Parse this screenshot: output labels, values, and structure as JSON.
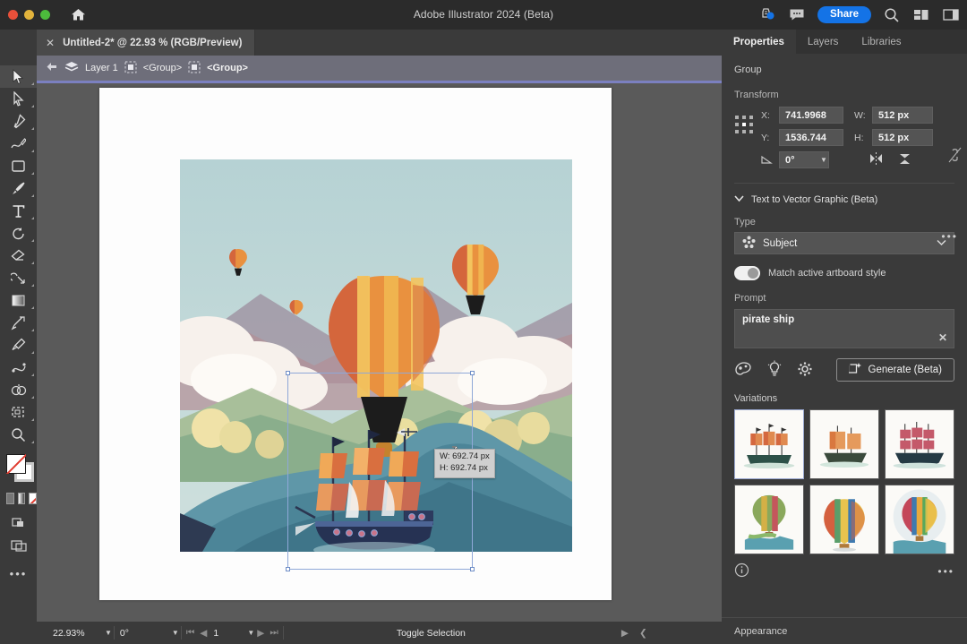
{
  "window": {
    "app_title": "Adobe Illustrator 2024 (Beta)",
    "home_icon": "home-icon",
    "traffic_lights": [
      "close",
      "minimize",
      "maximize"
    ],
    "share_label": "Share",
    "icons": [
      "cloud-sync-icon",
      "comment-icon",
      "search-icon",
      "workspace-icon",
      "panel-icon"
    ]
  },
  "tab": {
    "close_icon": "close-icon",
    "title": "Untitled-2* @ 22.93 % (RGB/Preview)"
  },
  "breadcrumb": {
    "back_icon": "back-arrow-icon",
    "layers_icon": "layers-icon",
    "layer": "Layer 1",
    "group1_icon": "group-icon",
    "group1": "<Group>",
    "group2_icon": "group-icon",
    "group2": "<Group>"
  },
  "toolbar": {
    "tools": [
      {
        "name": "selection-tool",
        "selected": true
      },
      {
        "name": "direct-selection-tool",
        "selected": false
      },
      {
        "name": "pen-tool",
        "selected": false
      },
      {
        "name": "curvature-tool",
        "selected": false
      },
      {
        "name": "rectangle-tool",
        "selected": false
      },
      {
        "name": "paintbrush-tool",
        "selected": false
      },
      {
        "name": "type-tool",
        "selected": false
      },
      {
        "name": "rotate-tool",
        "selected": false
      },
      {
        "name": "eraser-tool",
        "selected": false
      },
      {
        "name": "scale-tool",
        "selected": false
      },
      {
        "name": "gradient-tool",
        "selected": false
      },
      {
        "name": "width-tool",
        "selected": false
      },
      {
        "name": "eyedropper-tool",
        "selected": false
      },
      {
        "name": "blend-tool",
        "selected": false
      },
      {
        "name": "shape-builder-tool",
        "selected": false
      },
      {
        "name": "artboard-tool",
        "selected": false
      },
      {
        "name": "zoom-tool",
        "selected": false
      }
    ],
    "more_label": "•••"
  },
  "canvas": {
    "tooltip_w": "W: 692.74 px",
    "tooltip_h": "H: 692.74 px",
    "artwork_description": "hot air balloon landscape with pirate ship"
  },
  "statusbar": {
    "zoom": "22.93%",
    "rotation": "0°",
    "artboard_number": "1",
    "mode": "Toggle Selection",
    "nav_next_icon": "next-icon",
    "nav_prev_icon": "prev-icon"
  },
  "properties": {
    "tabs": [
      {
        "label": "Properties",
        "active": true
      },
      {
        "label": "Layers",
        "active": false
      },
      {
        "label": "Libraries",
        "active": false
      }
    ],
    "object_type": "Group",
    "transform": {
      "title": "Transform",
      "reference_point_icon": "reference-point-icon",
      "x_label": "X:",
      "x_value": "741.9968",
      "y_label": "Y:",
      "y_value": "1536.744",
      "w_label": "W:",
      "w_value": "512 px",
      "h_label": "H:",
      "h_value": "512 px",
      "angle_label": "angle-icon",
      "angle_value": "0°",
      "link_icon": "link-broken-icon",
      "flip_h_icon": "flip-horizontal-icon",
      "flip_v_icon": "flip-vertical-icon",
      "more_icon": "more-options-icon"
    },
    "text_to_vector": {
      "section_title": "Text to Vector Graphic (Beta)",
      "chevron_icon": "chevron-down-icon",
      "type_label": "Type",
      "type_icon": "subject-icon",
      "type_value": "Subject",
      "type_chevron": "chevron-down-icon",
      "match_style_label": "Match active artboard style",
      "match_style_on": true,
      "prompt_label": "Prompt",
      "prompt_value": "pirate ship",
      "prompt_clear_icon": "close-icon",
      "tool_icons": [
        "style-reference-icon",
        "inspire-icon",
        "settings-gear-icon"
      ],
      "generate_label": "Generate (Beta)",
      "generate_icon": "generate-icon"
    },
    "variations": {
      "label": "Variations",
      "items": [
        {
          "name": "variation-ship-1",
          "kind": "ship",
          "selected": true
        },
        {
          "name": "variation-ship-2",
          "kind": "ship",
          "selected": false
        },
        {
          "name": "variation-ship-3",
          "kind": "ship",
          "selected": false
        },
        {
          "name": "variation-balloon-1",
          "kind": "balloon",
          "selected": false
        },
        {
          "name": "variation-balloon-2",
          "kind": "balloon",
          "selected": false
        },
        {
          "name": "variation-balloon-3",
          "kind": "balloon",
          "selected": false
        }
      ]
    },
    "footer": {
      "info_icon": "info-icon",
      "more_icon": "more-options-icon"
    },
    "appearance_label": "Appearance"
  },
  "colors": {
    "accent_blue": "#1473e6",
    "panel_bg": "#3a3a3a",
    "canvas_bg": "#5a5a5a",
    "breadcrumb_bg": "#6e6e7a"
  }
}
